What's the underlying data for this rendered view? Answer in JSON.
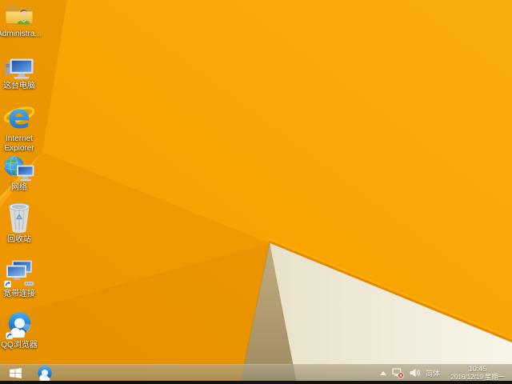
{
  "desktop_icons": {
    "admin": {
      "label": "Administra...",
      "icon": "user-folder-icon"
    },
    "this_pc": {
      "label": "这台电脑",
      "icon": "computer-icon"
    },
    "ie": {
      "label_line1": "Internet",
      "label_line2": "Explorer",
      "icon": "internet-explorer-icon"
    },
    "network": {
      "label": "网络",
      "icon": "network-globe-icon"
    },
    "recycle_bin": {
      "label": "回收站",
      "icon": "recycle-bin-icon"
    },
    "broadband": {
      "label": "宽带连接",
      "icon": "broadband-connection-icon"
    },
    "qq_browser": {
      "label": "QQ浏览器",
      "icon": "qq-browser-icon"
    }
  },
  "taskbar": {
    "start": {
      "icon": "windows-start-icon"
    },
    "pinned": [
      {
        "icon": "qq-browser-icon"
      }
    ],
    "tray": {
      "hidden_icons_arrow": "show-hidden-icons-arrow",
      "network_status_icon": "network-disconnected-icon",
      "volume_icon": "speaker-icon",
      "input_language": "简体",
      "time": "10:45",
      "date": "2016/12/19 星期一"
    }
  },
  "colors": {
    "wallpaper_orange": "#f8a502",
    "wallpaper_dark_orange": "#e18c00",
    "facet_white": "#efe9d8",
    "facet_tan": "#ab986a",
    "taskbar_tint": "#b5a87f",
    "ie_blue": "#1f78d4",
    "qq_blue": "#1a6fd0",
    "network_error_red": "#d2281e",
    "label_text": "#ffffff"
  }
}
